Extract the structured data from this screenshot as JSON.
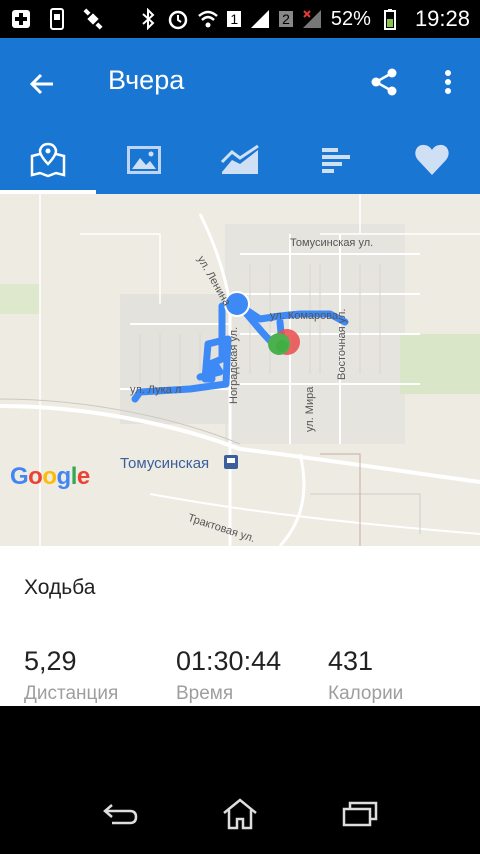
{
  "status_bar": {
    "sim1": "1",
    "sim2": "2",
    "battery": "52%",
    "time": "19:28"
  },
  "app_bar": {
    "title": "Вчера",
    "color": "#1976d2"
  },
  "tabs": [
    {
      "icon": "map-icon",
      "active": true
    },
    {
      "icon": "photos-icon",
      "active": false
    },
    {
      "icon": "chart-icon",
      "active": false
    },
    {
      "icon": "list-bars-icon",
      "active": false
    },
    {
      "icon": "heart-icon",
      "active": false
    }
  ],
  "map": {
    "streets": {
      "tomusinskaya_top": "Томусинская ул.",
      "lenina": "ул. Ленина",
      "komarova": "ул. Комарова",
      "vostochnaya": "Восточная ул.",
      "nagradskaya": "Ноградская ул.",
      "mira": "ул. Мира",
      "luka": "ул. Лука л",
      "station": "Томусинская",
      "traktovaya": "Трактовая ул."
    },
    "logo": "Google",
    "route_color": "#3d8af7",
    "start_color": "#4caf50",
    "end_color": "#e84c4c"
  },
  "activity": {
    "name": "Ходьба",
    "stats": [
      {
        "value": "5,29",
        "label": "Дистанция"
      },
      {
        "value": "01:30:44",
        "label": "Время"
      },
      {
        "value": "431",
        "label": "Калории"
      }
    ]
  }
}
